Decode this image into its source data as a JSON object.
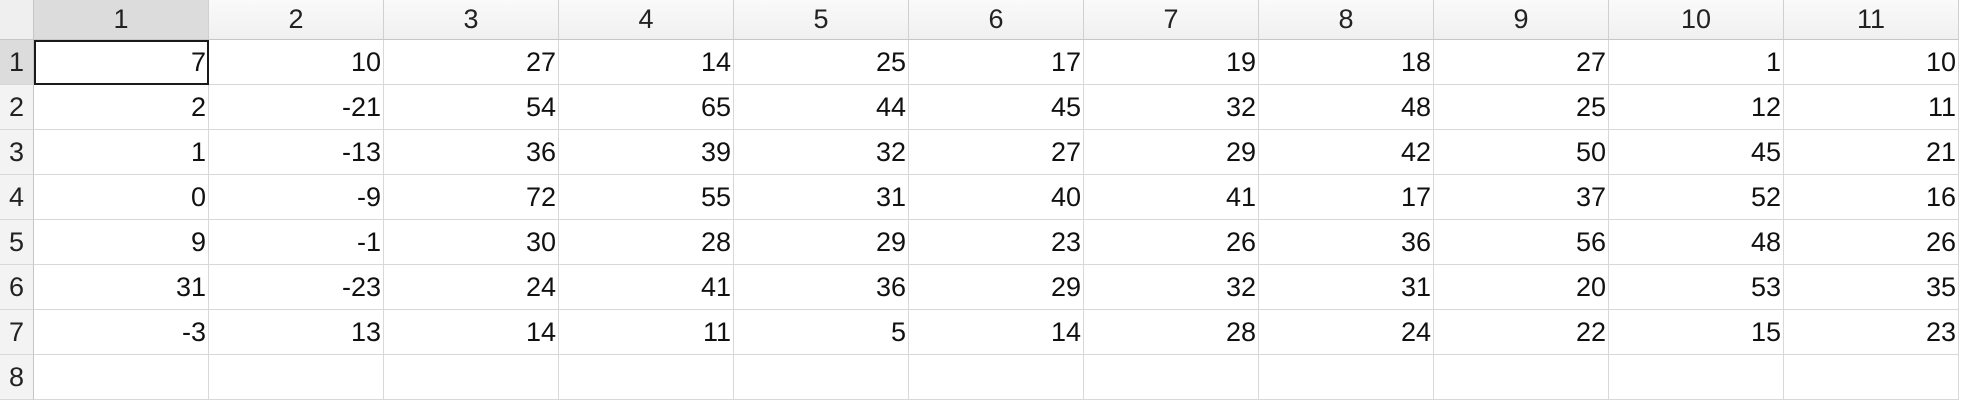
{
  "spreadsheet": {
    "columns": [
      "1",
      "2",
      "3",
      "4",
      "5",
      "6",
      "7",
      "8",
      "9",
      "10",
      "11"
    ],
    "rows": [
      "1",
      "2",
      "3",
      "4",
      "5",
      "6",
      "7",
      "8"
    ],
    "active_column": 0,
    "active_row": 0,
    "selected_cell": "1,1",
    "cells": [
      [
        "7",
        "10",
        "27",
        "14",
        "25",
        "17",
        "19",
        "18",
        "27",
        "1",
        "10"
      ],
      [
        "2",
        "-21",
        "54",
        "65",
        "44",
        "45",
        "32",
        "48",
        "25",
        "12",
        "11"
      ],
      [
        "1",
        "-13",
        "36",
        "39",
        "32",
        "27",
        "29",
        "42",
        "50",
        "45",
        "21"
      ],
      [
        "0",
        "-9",
        "72",
        "55",
        "31",
        "40",
        "41",
        "17",
        "37",
        "52",
        "16"
      ],
      [
        "9",
        "-1",
        "30",
        "28",
        "29",
        "23",
        "26",
        "36",
        "56",
        "48",
        "26"
      ],
      [
        "31",
        "-23",
        "24",
        "41",
        "36",
        "29",
        "32",
        "31",
        "20",
        "53",
        "35"
      ],
      [
        "-3",
        "13",
        "14",
        "11",
        "5",
        "14",
        "28",
        "24",
        "22",
        "15",
        "23"
      ],
      [
        "",
        "",
        "",
        "",
        "",
        "",
        "",
        "",
        "",
        "",
        ""
      ]
    ]
  }
}
